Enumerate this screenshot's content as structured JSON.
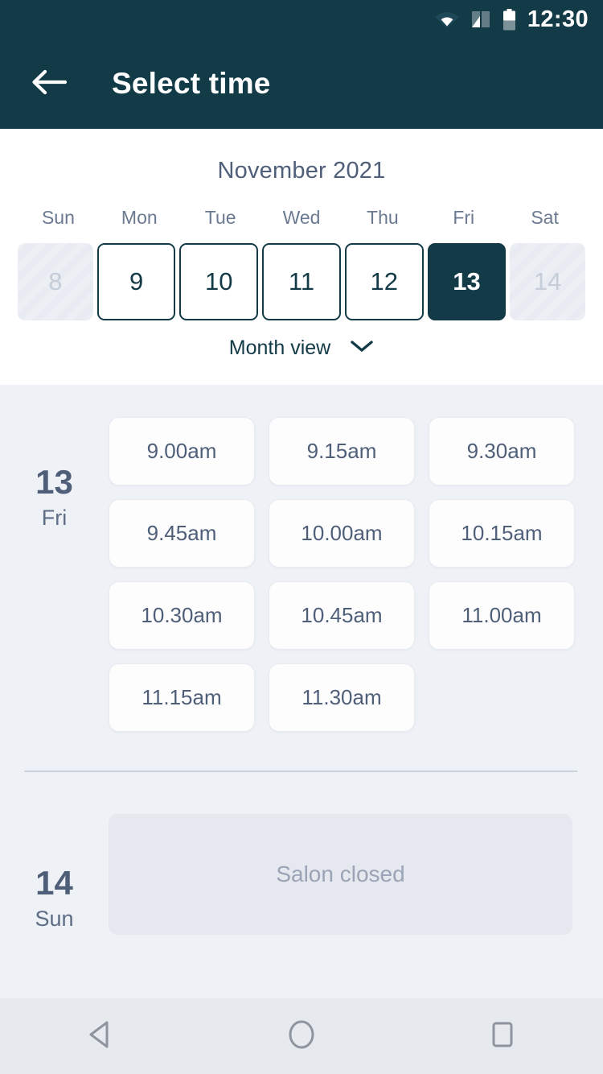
{
  "status_bar": {
    "time": "12:30",
    "icons": [
      "wifi-icon",
      "signal-icon",
      "battery-icon"
    ]
  },
  "app_bar": {
    "back_icon": "back-arrow-icon",
    "title": "Select time"
  },
  "calendar": {
    "month_label": "November 2021",
    "weekday_headers": [
      "Sun",
      "Mon",
      "Tue",
      "Wed",
      "Thu",
      "Fri",
      "Sat"
    ],
    "days": [
      {
        "number": "8",
        "state": "disabled"
      },
      {
        "number": "9",
        "state": "available"
      },
      {
        "number": "10",
        "state": "available"
      },
      {
        "number": "11",
        "state": "available"
      },
      {
        "number": "12",
        "state": "available"
      },
      {
        "number": "13",
        "state": "selected"
      },
      {
        "number": "14",
        "state": "disabled"
      }
    ],
    "month_view_label": "Month view",
    "month_view_icon": "chevron-down-icon"
  },
  "schedule": {
    "days": [
      {
        "day_number": "13",
        "day_name": "Fri",
        "slots": [
          "9.00am",
          "9.15am",
          "9.30am",
          "9.45am",
          "10.00am",
          "10.15am",
          "10.30am",
          "10.45am",
          "11.00am",
          "11.15am",
          "11.30am"
        ]
      },
      {
        "day_number": "14",
        "day_name": "Sun",
        "closed_label": "Salon closed"
      }
    ]
  },
  "nav_bar": {
    "back_icon": "nav-back-triangle-icon",
    "home_icon": "nav-home-circle-icon",
    "recents_icon": "nav-recents-square-icon"
  },
  "colors": {
    "brand_dark": "#123a47",
    "page_bg": "#eef1f6",
    "text_muted": "#505f79",
    "closed_bg": "#e5e8ee"
  }
}
